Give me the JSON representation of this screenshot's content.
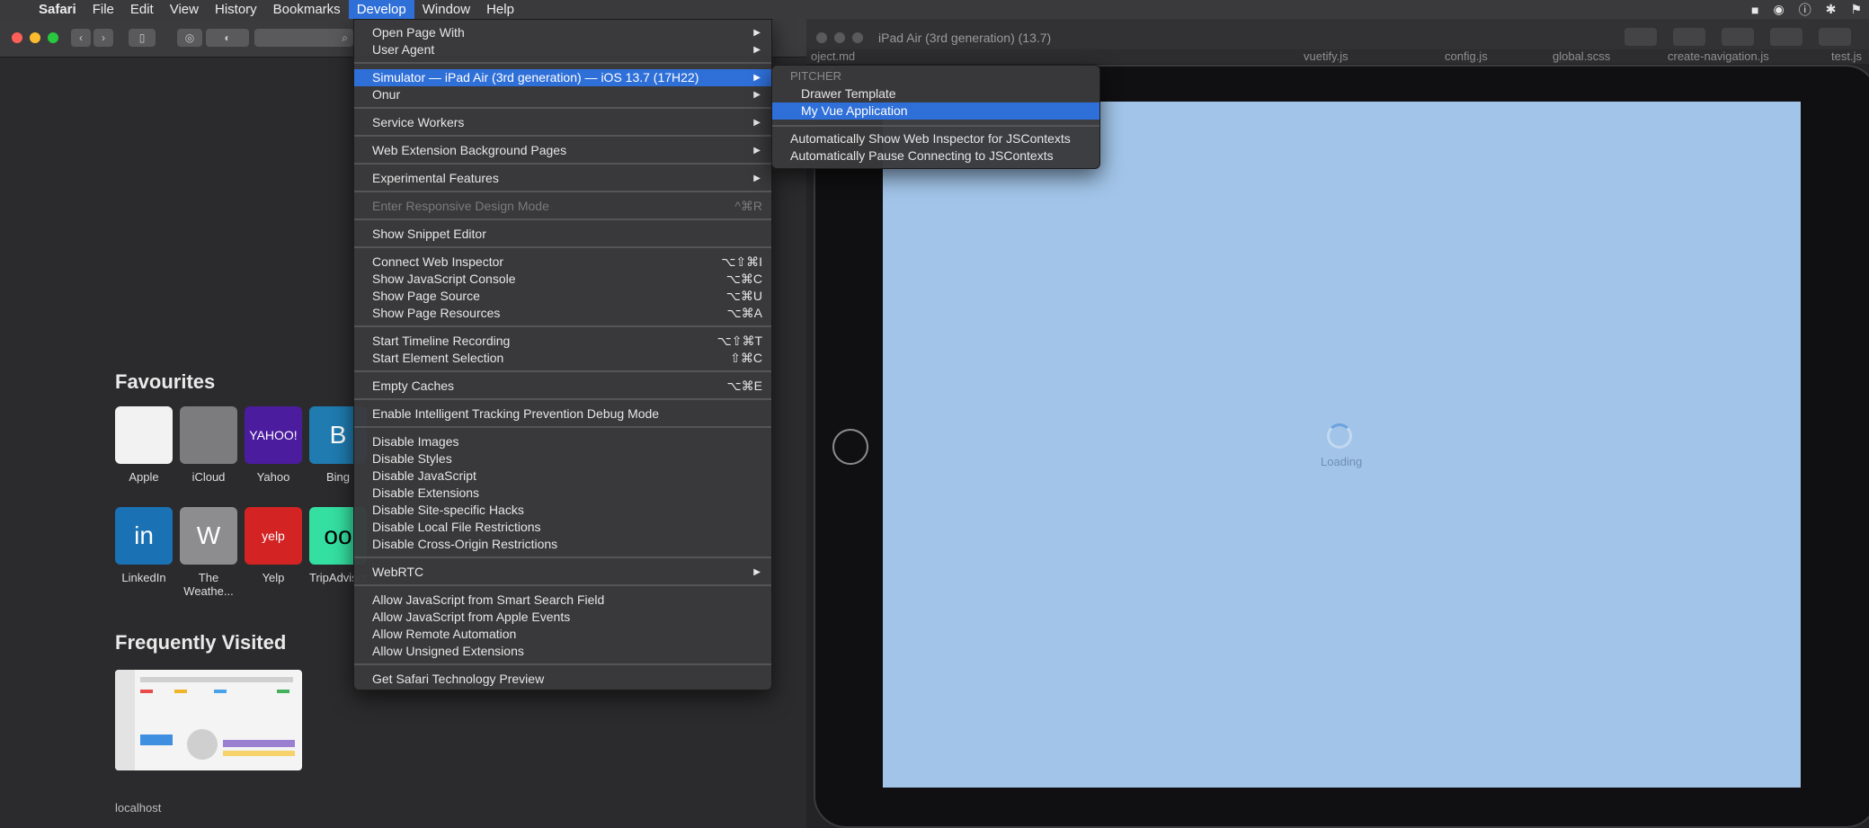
{
  "menubar": {
    "items": [
      "Safari",
      "File",
      "Edit",
      "View",
      "History",
      "Bookmarks",
      "Develop",
      "Window",
      "Help"
    ]
  },
  "safari": {
    "favourites_title": "Favourites",
    "favourites": [
      {
        "label": "Apple",
        "glyph": "",
        "bg": "#f2f2f2",
        "fg": "#8a8a8a"
      },
      {
        "label": "iCloud",
        "glyph": "",
        "bg": "#7c7c7e",
        "fg": "#d8d8d8"
      },
      {
        "label": "Yahoo",
        "glyph": "YAHOO!",
        "bg": "#4b1c9e",
        "fg": "#ffffff"
      },
      {
        "label": "Bing",
        "glyph": "B",
        "bg": "#1f7bb0",
        "fg": "#ffffff"
      },
      {
        "label": "LinkedIn",
        "glyph": "in",
        "bg": "#1a72b5",
        "fg": "#ffffff"
      },
      {
        "label": "The Weathe...",
        "glyph": "W",
        "bg": "#8d8d90",
        "fg": "#ffffff"
      },
      {
        "label": "Yelp",
        "glyph": "yelp",
        "bg": "#d32323",
        "fg": "#ffffff"
      },
      {
        "label": "TripAdvisor",
        "glyph": "oo",
        "bg": "#34e0a1",
        "fg": "#000000"
      }
    ],
    "frequently_visited_title": "Frequently Visited",
    "frequently_visited": [
      {
        "label": "localhost"
      }
    ]
  },
  "simulator": {
    "title": "iPad Air (3rd generation) (13.7)",
    "loading": "Loading"
  },
  "editor_tabs": [
    "oject.md",
    "vuetify.js",
    "config.js",
    "global.scss",
    "create-navigation.js",
    "test.js"
  ],
  "develop_menu": {
    "groups": [
      [
        {
          "label": "Open Page With",
          "submenu": true
        },
        {
          "label": "User Agent",
          "submenu": true
        }
      ],
      [
        {
          "label": "Simulator — iPad Air (3rd generation) — iOS 13.7 (17H22)",
          "submenu": true,
          "highlight": true
        },
        {
          "label": "Onur",
          "submenu": true
        }
      ],
      [
        {
          "label": "Service Workers",
          "submenu": true
        }
      ],
      [
        {
          "label": "Web Extension Background Pages",
          "submenu": true
        }
      ],
      [
        {
          "label": "Experimental Features",
          "submenu": true
        }
      ],
      [
        {
          "label": "Enter Responsive Design Mode",
          "shortcut": "^⌘R",
          "disabled": true
        }
      ],
      [
        {
          "label": "Show Snippet Editor"
        }
      ],
      [
        {
          "label": "Connect Web Inspector",
          "shortcut": "⌥⇧⌘I"
        },
        {
          "label": "Show JavaScript Console",
          "shortcut": "⌥⌘C"
        },
        {
          "label": "Show Page Source",
          "shortcut": "⌥⌘U"
        },
        {
          "label": "Show Page Resources",
          "shortcut": "⌥⌘A"
        }
      ],
      [
        {
          "label": "Start Timeline Recording",
          "shortcut": "⌥⇧⌘T"
        },
        {
          "label": "Start Element Selection",
          "shortcut": "⇧⌘C"
        }
      ],
      [
        {
          "label": "Empty Caches",
          "shortcut": "⌥⌘E"
        }
      ],
      [
        {
          "label": "Enable Intelligent Tracking Prevention Debug Mode"
        }
      ],
      [
        {
          "label": "Disable Images"
        },
        {
          "label": "Disable Styles"
        },
        {
          "label": "Disable JavaScript"
        },
        {
          "label": "Disable Extensions"
        },
        {
          "label": "Disable Site-specific Hacks"
        },
        {
          "label": "Disable Local File Restrictions"
        },
        {
          "label": "Disable Cross-Origin Restrictions"
        }
      ],
      [
        {
          "label": "WebRTC",
          "submenu": true
        }
      ],
      [
        {
          "label": "Allow JavaScript from Smart Search Field"
        },
        {
          "label": "Allow JavaScript from Apple Events"
        },
        {
          "label": "Allow Remote Automation"
        },
        {
          "label": "Allow Unsigned Extensions"
        }
      ],
      [
        {
          "label": "Get Safari Technology Preview"
        }
      ]
    ]
  },
  "sub_menu": {
    "header": "PITCHER",
    "items": [
      {
        "label": "Drawer Template"
      },
      {
        "label": "My Vue Application",
        "highlight": true
      }
    ],
    "options": [
      {
        "label": "Automatically Show Web Inspector for JSContexts"
      },
      {
        "label": "Automatically Pause Connecting to JSContexts"
      }
    ]
  }
}
